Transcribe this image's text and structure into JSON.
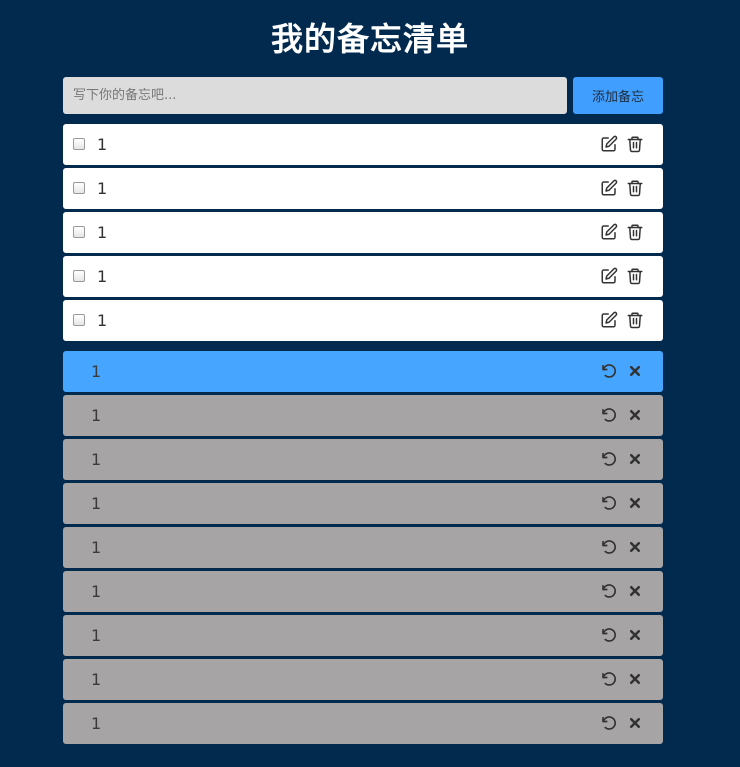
{
  "title": "我的备忘清单",
  "input": {
    "placeholder": "写下你的备忘吧...",
    "value": ""
  },
  "add_button_label": "添加备忘",
  "todo_items": [
    {
      "text": "1",
      "checked": false
    },
    {
      "text": "1",
      "checked": false
    },
    {
      "text": "1",
      "checked": false
    },
    {
      "text": "1",
      "checked": false
    },
    {
      "text": "1",
      "checked": false
    }
  ],
  "done_items": [
    {
      "text": "1",
      "highlighted": true
    },
    {
      "text": "1",
      "highlighted": false
    },
    {
      "text": "1",
      "highlighted": false
    },
    {
      "text": "1",
      "highlighted": false
    },
    {
      "text": "1",
      "highlighted": false
    },
    {
      "text": "1",
      "highlighted": false
    },
    {
      "text": "1",
      "highlighted": false
    },
    {
      "text": "1",
      "highlighted": false
    },
    {
      "text": "1",
      "highlighted": false
    }
  ],
  "icons": {
    "todo": [
      "edit-icon",
      "trash-icon"
    ],
    "done": [
      "undo-icon",
      "delete-x-icon"
    ]
  },
  "colors": {
    "background": "#022a4f",
    "accent": "#409eff",
    "done_row": "#a6a4a4",
    "todo_row": "#ffffff"
  }
}
